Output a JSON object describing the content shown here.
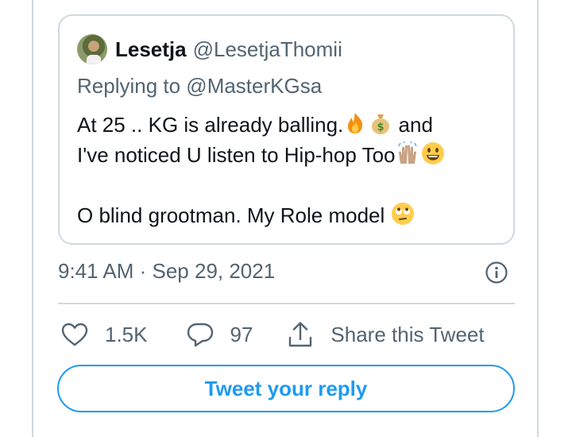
{
  "quoted_tweet": {
    "author_name": "Lesetja",
    "author_handle": "@LesetjaThomii",
    "replying_to": "Replying to @MasterKGsa",
    "line1_a": "At 25 .. KG is already balling.",
    "line1_b": " and",
    "line2": "I've noticed U listen to Hip-hop Too",
    "line3": "O blind grootman. My Role model ",
    "emojis": [
      "fire-emoji",
      "money-bag-emoji",
      "raising-hands-emoji",
      "grinning-face-emoji",
      "face-with-rolling-eyes-emoji"
    ]
  },
  "tweet_meta": {
    "timestamp": "9:41 AM · Sep 29, 2021"
  },
  "actions": {
    "likes": "1.5K",
    "replies": "97",
    "share_label": "Share this Tweet"
  },
  "reply_button": {
    "label": "Tweet your reply"
  },
  "colors": {
    "accent": "#1d9bf0",
    "secondary_text": "#536471",
    "border": "#cfd9de"
  }
}
